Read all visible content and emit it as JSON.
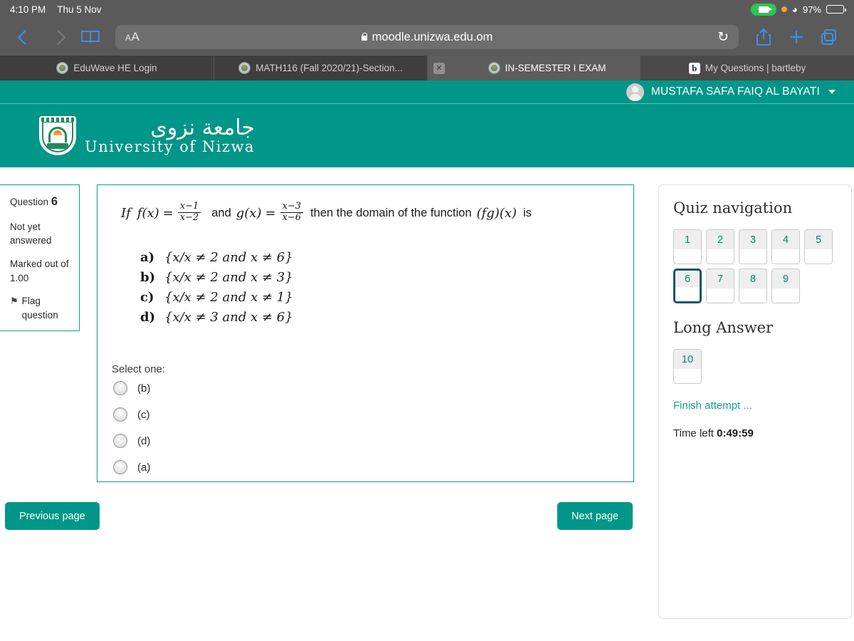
{
  "status_bar": {
    "time": "4:10 PM",
    "date": "Thu 5 Nov",
    "battery_percent": "97%",
    "camera_icon": "camera-recording-icon",
    "privacy_dot_icon": "orange-privacy-dot-icon",
    "wifi_icon": "wifi-icon",
    "battery_icon": "battery-icon"
  },
  "browser": {
    "back_icon": "chevron-left-icon",
    "forward_icon": "chevron-right-icon",
    "reader_icon": "book-reader-icon",
    "text_size_small": "A",
    "text_size_large": "A",
    "lock_icon": "lock-icon",
    "url": "moodle.unizwa.edu.om",
    "reload_glyph": "↻",
    "share_icon": "share-icon",
    "new_tab_icon": "plus-icon",
    "tabs_icon": "tabs-overview-icon"
  },
  "tabs": [
    {
      "label": "EduWave HE Login",
      "icon": "site-favicon",
      "active": false,
      "closable": false
    },
    {
      "label": "MATH116 (Fall 2020/21)-Section...",
      "icon": "site-favicon",
      "active": false,
      "closable": false
    },
    {
      "label": "IN-SEMESTER I EXAM",
      "icon": "site-favicon",
      "active": true,
      "closable": true,
      "close_glyph": "✕"
    },
    {
      "label": "My Questions | bartleby",
      "icon": "bartleby-favicon",
      "favicon_letter": "b",
      "active": false,
      "closable": false
    }
  ],
  "user_bar": {
    "avatar_icon": "user-avatar-icon",
    "user_name": "MUSTAFA SAFA FAIQ AL BAYATI",
    "caret_icon": "chevron-down-icon"
  },
  "site_header": {
    "crest_icon": "university-of-nizwa-crest-icon",
    "name_arabic": "جامعة نزوى",
    "name_english": "University of Nizwa",
    "background_color": "#009688"
  },
  "question_info": {
    "question_label": "Question",
    "question_number": "6",
    "state": "Not yet answered",
    "marked_out_of": "Marked out of 1.00",
    "flag_icon": "flag-icon",
    "flag_label": "Flag question"
  },
  "question": {
    "stem_prefix": "If",
    "f_label": "f(x)",
    "equals": "=",
    "f_numerator": "x−1",
    "f_denominator": "x−2",
    "conjunction": "and",
    "g_label": "g(x)",
    "g_numerator": "x−3",
    "g_denominator": "x−6",
    "stem_suffix": "then the domain of the function",
    "function_expr": "(fg)(x)",
    "stem_end": "is",
    "options": [
      {
        "letter": "a)",
        "text": "{x/x ≠ 2 and x ≠ 6}"
      },
      {
        "letter": "b)",
        "text": "{x/x ≠ 2 and x ≠ 3}"
      },
      {
        "letter": "c)",
        "text": "{x/x ≠ 2 and x ≠ 1}"
      },
      {
        "letter": "d)",
        "text": "{x/x ≠ 3 and x ≠ 6}"
      }
    ],
    "select_one_label": "Select one:",
    "answers": [
      {
        "label": "(b)",
        "selected": false
      },
      {
        "label": "(c)",
        "selected": false
      },
      {
        "label": "(d)",
        "selected": false
      },
      {
        "label": "(a)",
        "selected": false
      }
    ]
  },
  "quiz_navigation": {
    "title": "Quiz navigation",
    "buttons": [
      "1",
      "2",
      "3",
      "4",
      "5",
      "6",
      "7",
      "8",
      "9"
    ],
    "current": "6",
    "long_answer_title": "Long Answer",
    "long_answer_buttons": [
      "10"
    ],
    "finish_attempt": "Finish attempt ...",
    "time_left_label": "Time left",
    "time_left_value": "0:49:59",
    "accent_color": "#0f8577",
    "current_border_color": "#14556b"
  },
  "footer": {
    "previous_label": "Previous page",
    "next_label": "Next page",
    "button_color": "#009688"
  }
}
